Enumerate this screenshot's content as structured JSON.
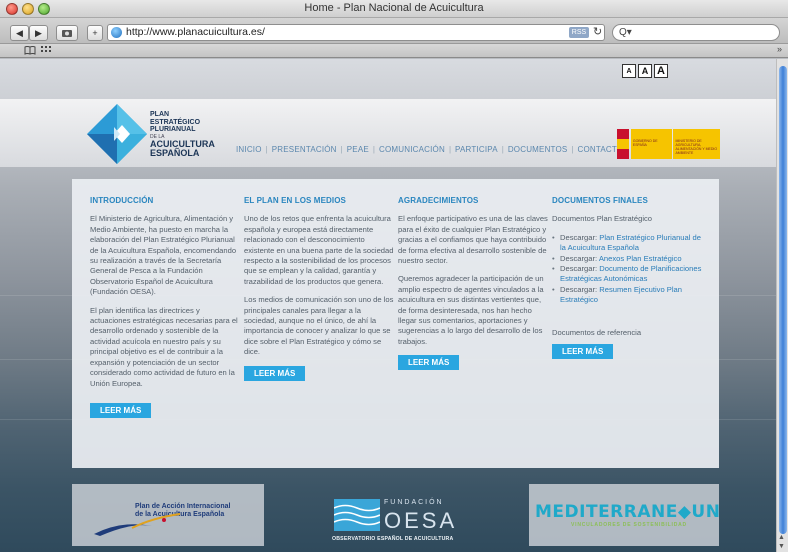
{
  "window": {
    "title": "Home - Plan Nacional de Acuicultura"
  },
  "toolbar": {
    "back_glyph": "◀",
    "forward_glyph": "▶",
    "add_glyph": "+",
    "url": "http://www.planacuicultura.es/",
    "rss_label": "RSS",
    "search_placeholder": "Q▾"
  },
  "bookmarks": {
    "book_icon": "book-icon",
    "grid_icon": "grid-icon",
    "more": "»"
  },
  "text_size": {
    "small": "A",
    "medium": "A",
    "large": "A"
  },
  "logo": {
    "line1": "PLAN",
    "line2": "ESTRATÉGICO",
    "line3": "PLURIANUAL",
    "line4": "DE LA",
    "line5": "ACUICULTURA",
    "line6": "ESPAÑOLA"
  },
  "nav": {
    "items": [
      "INICIO",
      "PRESENTACIÓN",
      "PEAE",
      "COMUNICACIÓN",
      "PARTICIPA",
      "DOCUMENTOS",
      "CONTACTO"
    ]
  },
  "gov": {
    "block1": "GOBIERNO DE ESPAÑA",
    "block2": "MINISTERIO DE AGRICULTURA, ALIMENTACIÓN Y MEDIO AMBIENTE"
  },
  "columns": {
    "intro": {
      "title": "INTRODUCCIÓN",
      "p1": "El Ministerio de Agricultura, Alimentación y Medio Ambiente, ha puesto en marcha la elaboración del Plan Estratégico Plurianual de la Acuicultura Española, encomendando su realización a través de la Secretaría General de Pesca a la Fundación Observatorio Español de Acuicultura (Fundación OESA).",
      "p2": "El plan identifica las directrices y actuaciones estratégicas necesarias para el desarrollo ordenado y sostenible de la actividad acuícola en nuestro país y su principal objetivo es el de contribuir a la expansión y potenciación de un sector considerado como actividad de futuro en la Unión Europea.",
      "button": "LEER MÁS"
    },
    "medios": {
      "title": "EL PLAN EN LOS MEDIOS",
      "p1": "Uno de los retos que enfrenta la acuicultura española y europea está directamente relacionado con el desconocimiento existente en una buena parte de la sociedad respecto a la sostenibilidad de los procesos que se emplean y la calidad, garantía y trazabilidad de los productos que genera.",
      "p2": "Los medios de comunicación son uno de los principales canales para llegar a la sociedad, aunque no el único, de ahí la importancia de conocer y analizar lo que se dice sobre el Plan Estratégico y cómo se dice.",
      "button": "LEER MÁS"
    },
    "agradecimientos": {
      "title": "AGRADECIMIENTOS",
      "p1": "El enfoque participativo es una de las claves para el éxito de cualquier Plan Estratégico y gracias a el confiamos que haya contribuido de forma efectiva al desarrollo sostenible de nuestro sector.",
      "p2": "Queremos agradecer la participación de un amplio espectro de agentes vinculados a la acuicultura en sus distintas vertientes que, de forma desinteresada, nos han hecho llegar sus comentarios, aportaciones y sugerencias a lo largo del desarrollo de los trabajos.",
      "button": "LEER MÁS"
    },
    "documentos": {
      "title": "DOCUMENTOS FINALES",
      "subtitle": "Documentos Plan Estratégico",
      "items": [
        {
          "prefix": "Descargar: ",
          "link": "Plan Estratégico Plurianual de la Acuicultura Española"
        },
        {
          "prefix": "Descargar: ",
          "link": "Anexos Plan Estratégico"
        },
        {
          "prefix": "Descargar: ",
          "link": "Documento de Planificaciones Estratégicas Autonómicas"
        },
        {
          "prefix": "Descargar: ",
          "link": "Resumen Ejecutivo Plan Estratégico"
        }
      ],
      "ref": "Documentos de referencia",
      "button": "LEER MÁS"
    }
  },
  "partners": {
    "pal_line1": "Plan de Acción Internacional",
    "pal_line2": "de la Acuicultura Española",
    "oesa_fund": "FUNDACIÓN",
    "oesa_name": "OESA",
    "oesa_sub": "OBSERVATORIO ESPAÑOL DE ACUICULTURA",
    "med_title": "MEDITERRANE◆UN",
    "med_sub": "VINCULADORES DE SOSTENIBILIDAD"
  },
  "colors": {
    "accent": "#2aa6e0",
    "heading": "#2a86bf",
    "nav": "#5b87ad"
  }
}
